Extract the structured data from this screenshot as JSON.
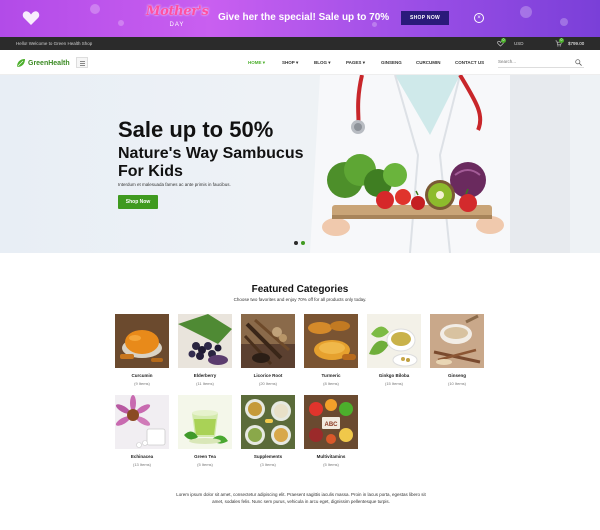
{
  "promo": {
    "logo_title": "Mother's",
    "logo_day": "DAY",
    "text": "Give her the special! Sale up to 70%",
    "button": "SHOP NOW",
    "close_glyph": "×",
    "colors": {
      "gradient_start": "#b24be8",
      "button_bg": "#2a1a7a",
      "logo_pink": "#ff4fa0"
    }
  },
  "topbar": {
    "welcome": "Hello! Welcome to Green Health Shop",
    "wishlist_count": "0",
    "currency": "USD",
    "cart_count": "0",
    "cart_total": "$799.00"
  },
  "header": {
    "brand": "GreenHealth",
    "nav": [
      {
        "label": "HOME",
        "caret": "▾",
        "active": true
      },
      {
        "label": "SHOP",
        "caret": "▾",
        "active": false
      },
      {
        "label": "BLOG",
        "caret": "▾",
        "active": false
      },
      {
        "label": "PAGES",
        "caret": "▾",
        "active": false
      },
      {
        "label": "GINSENG",
        "caret": "",
        "active": false
      },
      {
        "label": "CURCUMIN",
        "caret": "",
        "active": false
      },
      {
        "label": "CONTACT US",
        "caret": "",
        "active": false
      }
    ],
    "search_placeholder": "Search...",
    "accent": "#4caf2c"
  },
  "hero": {
    "headline": "Sale up to 50%",
    "subheadline": "Nature's Way Sambucus For Kids",
    "text": "Interdum et malesuada fames ac ante primis in faucibus.",
    "button": "Shop Now",
    "slides": 2,
    "active_slide": 1
  },
  "featured": {
    "title": "Featured Categories",
    "subtitle": "Choose two favorites and enjoy 70% off for all products only today.",
    "categories": [
      {
        "name": "Curcumin",
        "count": "(9 Items)",
        "icon": "turmeric-powder"
      },
      {
        "name": "Elderberry",
        "count": "(11 Items)",
        "icon": "elderberries"
      },
      {
        "name": "Licorice Root",
        "count": "(20 Items)",
        "icon": "licorice-root"
      },
      {
        "name": "Turmeric",
        "count": "(8 Items)",
        "icon": "turmeric-roots"
      },
      {
        "name": "Ginkgo Biloba",
        "count": "(15 Items)",
        "icon": "ginkgo-leaves"
      },
      {
        "name": "Ginseng",
        "count": "(10 Items)",
        "icon": "ginseng-mortar"
      },
      {
        "name": "Echinacea",
        "count": "(13 Items)",
        "icon": "echinacea-flower"
      },
      {
        "name": "Green Tea",
        "count": "(5 Items)",
        "icon": "green-tea-cup"
      },
      {
        "name": "Supplements",
        "count": "(3 Items)",
        "icon": "supplement-capsules"
      },
      {
        "name": "Multivitamins",
        "count": "(5 Items)",
        "icon": "multivitamin-food"
      }
    ]
  },
  "footer_text": "Lorem ipsum dolor sit amet, consectetur adipiscing elit. Praesent sagittis iaculis massa. Proin in lacus porta, egestas libero sit amet, sodales felis. Nunc sem purus, vehicula in arcu eget, dignissim pellentesque turpis."
}
